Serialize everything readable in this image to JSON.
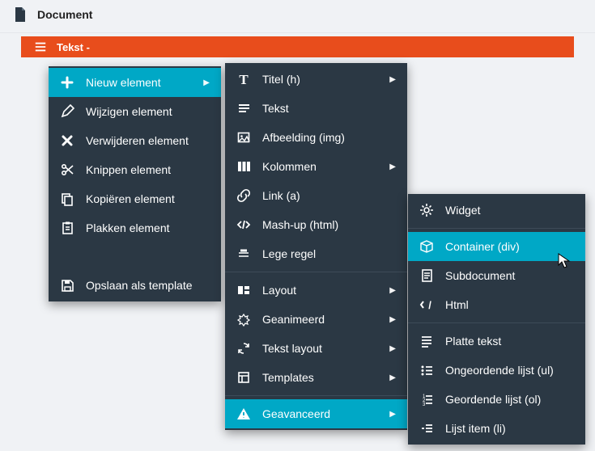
{
  "header": {
    "title": "Document"
  },
  "bar": {
    "label": "Tekst -"
  },
  "menu1": {
    "group1": [
      {
        "label": "Nieuw element",
        "icon": "plus",
        "sub": true,
        "hl": true
      },
      {
        "label": "Wijzigen element",
        "icon": "pencil"
      },
      {
        "label": "Verwijderen element",
        "icon": "close"
      },
      {
        "label": "Knippen element",
        "icon": "scissors"
      },
      {
        "label": "Kopiëren element",
        "icon": "copy"
      },
      {
        "label": "Plakken element",
        "icon": "paste"
      }
    ],
    "group2": [
      {
        "label": "Opslaan als template",
        "icon": "save"
      }
    ]
  },
  "menu2": {
    "group1": [
      {
        "label": "Titel (h)",
        "icon": "titleT",
        "sub": true
      },
      {
        "label": "Tekst",
        "icon": "lines"
      },
      {
        "label": "Afbeelding (img)",
        "icon": "image"
      },
      {
        "label": "Kolommen",
        "icon": "columns",
        "sub": true
      },
      {
        "label": "Link (a)",
        "icon": "link"
      },
      {
        "label": "Mash-up (html)",
        "icon": "code"
      },
      {
        "label": "Lege regel",
        "icon": "blank"
      }
    ],
    "group2": [
      {
        "label": "Layout",
        "icon": "layout",
        "sub": true
      },
      {
        "label": "Geanimeerd",
        "icon": "anim",
        "sub": true
      },
      {
        "label": "Tekst layout",
        "icon": "recycle",
        "sub": true
      },
      {
        "label": "Templates",
        "icon": "template",
        "sub": true
      }
    ],
    "group3": [
      {
        "label": "Geavanceerd",
        "icon": "warning",
        "sub": true,
        "hl": true
      }
    ]
  },
  "menu3": {
    "group1": [
      {
        "label": "Widget",
        "icon": "gear"
      }
    ],
    "group2": [
      {
        "label": "Container (div)",
        "icon": "box",
        "hl": true
      },
      {
        "label": "Subdocument",
        "icon": "doc"
      },
      {
        "label": "Html",
        "icon": "slash"
      }
    ],
    "group3": [
      {
        "label": "Platte tekst",
        "icon": "lines2"
      },
      {
        "label": "Ongeordende lijst (ul)",
        "icon": "ul"
      },
      {
        "label": "Geordende lijst (ol)",
        "icon": "ol"
      },
      {
        "label": "Lijst item (li)",
        "icon": "li"
      }
    ]
  }
}
